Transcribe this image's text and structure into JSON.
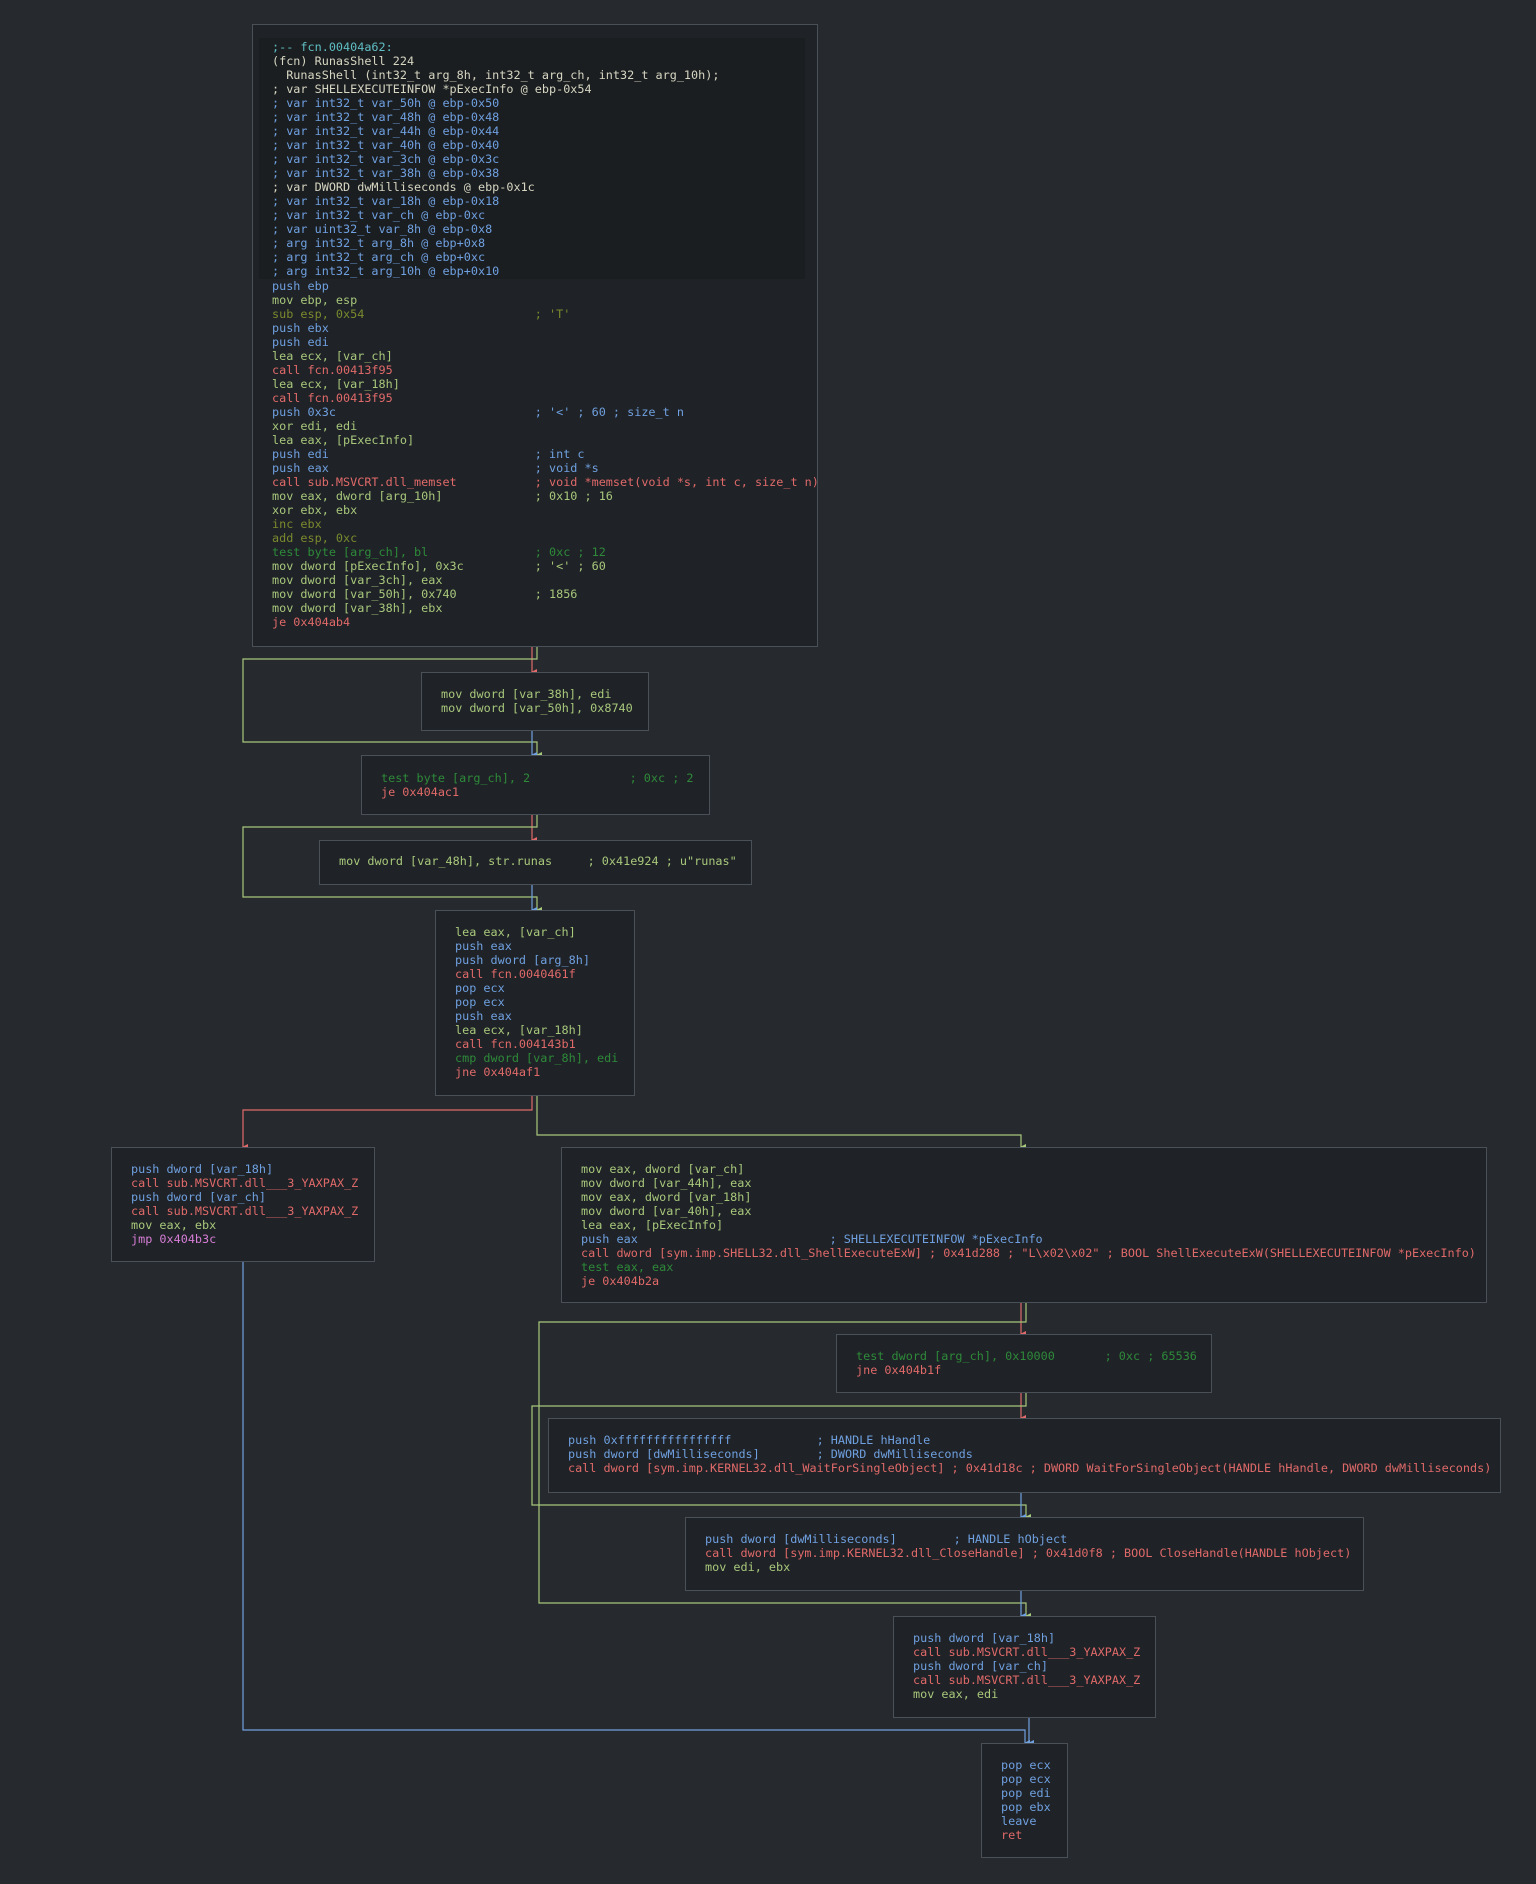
{
  "graph": {
    "theme": {
      "background": "#262a2e",
      "edge_true": "#a8c87c",
      "edge_false": "#e06a6a",
      "edge_jump": "#6fa0e0"
    },
    "blocks": [
      {
        "id": "block-fcn-00404a62",
        "header": [
          ";-- fcn.00404a62:",
          "(fcn) RunasShell 224",
          "  RunasShell (int32_t arg_8h, int32_t arg_ch, int32_t arg_10h);",
          "; var SHELLEXECUTEINFOW *pExecInfo @ ebp-0x54",
          "; var int32_t var_50h @ ebp-0x50",
          "; var int32_t var_48h @ ebp-0x48",
          "; var int32_t var_44h @ ebp-0x44",
          "; var int32_t var_40h @ ebp-0x40",
          "; var int32_t var_3ch @ ebp-0x3c",
          "; var int32_t var_38h @ ebp-0x38",
          "; var DWORD dwMilliseconds @ ebp-0x1c",
          "; var int32_t var_18h @ ebp-0x18",
          "; var int32_t var_ch @ ebp-0xc",
          "; var uint32_t var_8h @ ebp-0x8",
          "; arg int32_t arg_8h @ ebp+0x8",
          "; arg int32_t arg_ch @ ebp+0xc",
          "; arg int32_t arg_10h @ ebp+0x10"
        ],
        "lines": [
          "push ebp",
          "mov ebp, esp",
          "sub esp, 0x54                        ; 'T'",
          "push ebx",
          "push edi",
          "lea ecx, [var_ch]",
          "call fcn.00413f95",
          "lea ecx, [var_18h]",
          "call fcn.00413f95",
          "push 0x3c                            ; '<' ; 60 ; size_t n",
          "xor edi, edi",
          "lea eax, [pExecInfo]",
          "push edi                             ; int c",
          "push eax                             ; void *s",
          "call sub.MSVCRT.dll_memset           ; void *memset(void *s, int c, size_t n)",
          "mov eax, dword [arg_10h]             ; 0x10 ; 16",
          "xor ebx, ebx",
          "inc ebx",
          "add esp, 0xc",
          "test byte [arg_ch], bl               ; 0xc ; 12",
          "mov dword [pExecInfo], 0x3c          ; '<' ; 60",
          "mov dword [var_3ch], eax",
          "mov dword [var_50h], 0x740           ; 1856",
          "mov dword [var_38h], ebx",
          "je 0x404ab4"
        ]
      },
      {
        "id": "block-set-var38-var50",
        "lines": [
          "mov dword [var_38h], edi",
          "mov dword [var_50h], 0x8740"
        ]
      },
      {
        "id": "block-test-arg-ch-2",
        "lines": [
          "test byte [arg_ch], 2              ; 0xc ; 2",
          "je 0x404ac1"
        ]
      },
      {
        "id": "block-str-runas",
        "lines": [
          "mov dword [var_48h], str.runas     ; 0x41e924 ; u\"runas\""
        ]
      },
      {
        "id": "block-call-0040461f",
        "lines": [
          "lea eax, [var_ch]",
          "push eax",
          "push dword [arg_8h]",
          "call fcn.0040461f",
          "pop ecx",
          "pop ecx",
          "push eax",
          "lea ecx, [var_18h]",
          "call fcn.004143b1",
          "cmp dword [var_8h], edi",
          "jne 0x404af1"
        ]
      },
      {
        "id": "block-fail-cleanup",
        "lines": [
          "push dword [var_18h]",
          "call sub.MSVCRT.dll___3_YAXPAX_Z",
          "push dword [var_ch]",
          "call sub.MSVCRT.dll___3_YAXPAX_Z",
          "mov eax, ebx",
          "jmp 0x404b3c"
        ]
      },
      {
        "id": "block-shellexecute",
        "lines": [
          "mov eax, dword [var_ch]",
          "mov dword [var_44h], eax",
          "mov eax, dword [var_18h]",
          "mov dword [var_40h], eax",
          "lea eax, [pExecInfo]",
          "push eax                           ; SHELLEXECUTEINFOW *pExecInfo",
          "call dword [sym.imp.SHELL32.dll_ShellExecuteExW] ; 0x41d288 ; \"L\\x02\\x02\" ; BOOL ShellExecuteExW(SHELLEXECUTEINFOW *pExecInfo)",
          "test eax, eax",
          "je 0x404b2a"
        ]
      },
      {
        "id": "block-test-0x10000",
        "lines": [
          "test dword [arg_ch], 0x10000       ; 0xc ; 65536",
          "jne 0x404b1f"
        ]
      },
      {
        "id": "block-waitforsingleobject",
        "lines": [
          "push 0xffffffffffffffff            ; HANDLE hHandle",
          "push dword [dwMilliseconds]        ; DWORD dwMilliseconds",
          "call dword [sym.imp.KERNEL32.dll_WaitForSingleObject] ; 0x41d18c ; DWORD WaitForSingleObject(HANDLE hHandle, DWORD dwMilliseconds)"
        ]
      },
      {
        "id": "block-closehandle",
        "lines": [
          "push dword [dwMilliseconds]        ; HANDLE hObject",
          "call dword [sym.imp.KERNEL32.dll_CloseHandle] ; 0x41d0f8 ; BOOL CloseHandle(HANDLE hObject)",
          "mov edi, ebx"
        ]
      },
      {
        "id": "block-success-cleanup",
        "lines": [
          "push dword [var_18h]",
          "call sub.MSVCRT.dll___3_YAXPAX_Z",
          "push dword [var_ch]",
          "call sub.MSVCRT.dll___3_YAXPAX_Z",
          "mov eax, edi"
        ]
      },
      {
        "id": "block-epilogue",
        "lines": [
          "pop ecx",
          "pop ecx",
          "pop edi",
          "pop ebx",
          "leave",
          "ret"
        ]
      }
    ]
  }
}
